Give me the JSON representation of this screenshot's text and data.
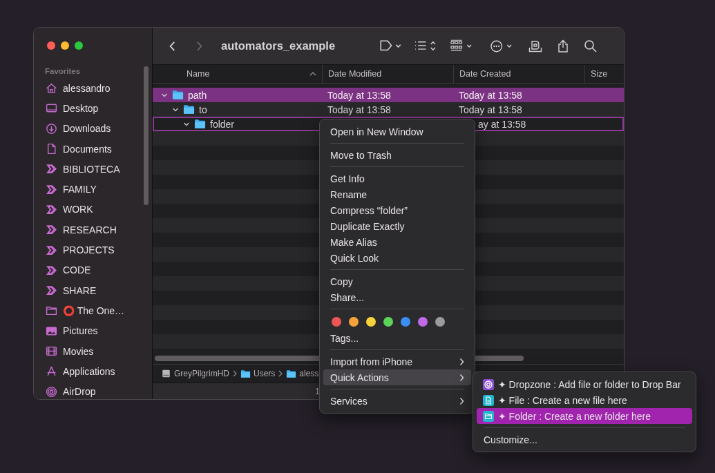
{
  "window": {
    "title": "automators_example"
  },
  "toolbar": {
    "back": {
      "disabled": false
    },
    "forward": {
      "disabled": true
    }
  },
  "sidebar": {
    "section": "Favorites",
    "items": [
      {
        "label": "alessandro",
        "kind": "home"
      },
      {
        "label": "Desktop",
        "kind": "desktop"
      },
      {
        "label": "Downloads",
        "kind": "downloads"
      },
      {
        "label": "Documents",
        "kind": "document"
      },
      {
        "label": "BIBLIOTECA",
        "kind": "shortcut"
      },
      {
        "label": "FAMILY",
        "kind": "shortcut"
      },
      {
        "label": "WORK",
        "kind": "shortcut"
      },
      {
        "label": "RESEARCH",
        "kind": "shortcut"
      },
      {
        "label": "PROJECTS",
        "kind": "shortcut"
      },
      {
        "label": "CODE",
        "kind": "shortcut"
      },
      {
        "label": "SHARE",
        "kind": "shortcut"
      },
      {
        "label": "⭕ The One…",
        "kind": "folder"
      },
      {
        "label": "Pictures",
        "kind": "pictures"
      },
      {
        "label": "Movies",
        "kind": "movies"
      },
      {
        "label": "Applications",
        "kind": "applications"
      },
      {
        "label": "AirDrop",
        "kind": "airdrop"
      }
    ]
  },
  "table": {
    "columns": [
      {
        "label": "Name",
        "sorted": true
      },
      {
        "label": "Date Modified",
        "sorted": false
      },
      {
        "label": "Date Created",
        "sorted": false
      },
      {
        "label": "Size",
        "sorted": false
      }
    ],
    "rows": [
      {
        "name": "path",
        "modified": "Today at 13:58",
        "created": "Today at 13:58",
        "expanded": true,
        "selected": true,
        "context_target": false,
        "children": [
          {
            "name": "to",
            "modified": "Today at 13:58",
            "created": "Today at 13:58",
            "expanded": true,
            "selected": false,
            "context_target": false,
            "children": [
              {
                "name": "folder",
                "created": "ay at 13:58",
                "created_cut": true,
                "expanded": true,
                "selected": false,
                "context_target": true
              }
            ]
          }
        ]
      }
    ]
  },
  "path_bar": {
    "left": [
      {
        "label": "GreyPilgrimHD",
        "kind": "disk"
      },
      {
        "label": "Users",
        "kind": "folder"
      },
      {
        "label": "aless",
        "kind": "folder"
      }
    ]
  },
  "status_bar": {
    "text": "1"
  },
  "context_menu": {
    "items": [
      {
        "kind": "item",
        "label": "Open in New Window"
      },
      {
        "kind": "separator"
      },
      {
        "kind": "item",
        "label": "Move to Trash"
      },
      {
        "kind": "separator"
      },
      {
        "kind": "item",
        "label": "Get Info"
      },
      {
        "kind": "item",
        "label": "Rename"
      },
      {
        "kind": "item",
        "label": "Compress “folder”"
      },
      {
        "kind": "item",
        "label": "Duplicate Exactly"
      },
      {
        "kind": "item",
        "label": "Make Alias"
      },
      {
        "kind": "item",
        "label": "Quick Look"
      },
      {
        "kind": "separator"
      },
      {
        "kind": "item",
        "label": "Copy"
      },
      {
        "kind": "item",
        "label": "Share..."
      },
      {
        "kind": "separator"
      },
      {
        "kind": "tags",
        "tags": [
          {
            "color": "#ef5552"
          },
          {
            "color": "#f5a23a"
          },
          {
            "color": "#f4d33b"
          },
          {
            "color": "#5cd45a"
          },
          {
            "color": "#3a8ff5"
          },
          {
            "color": "#c06ae8"
          },
          {
            "color": "#9b9b9b"
          }
        ]
      },
      {
        "kind": "item",
        "label": "Tags..."
      },
      {
        "kind": "separator"
      },
      {
        "kind": "submenu",
        "label": "Import from iPhone",
        "selected": false
      },
      {
        "kind": "submenu",
        "label": "Quick Actions",
        "selected": true
      },
      {
        "kind": "separator"
      },
      {
        "kind": "submenu",
        "label": "Services",
        "selected": false
      }
    ]
  },
  "submenu": {
    "items": [
      {
        "kind": "dropzone",
        "label": "✦ Dropzone : Add file or folder to Drop Bar",
        "selected": false
      },
      {
        "kind": "file",
        "label": "✦ File : Create a new file here",
        "selected": false
      },
      {
        "kind": "folder",
        "label": "✦ Folder : Create a new folder here",
        "selected": true
      },
      {
        "kind": "separator"
      },
      {
        "kind": "item",
        "label": "Customize..."
      }
    ]
  }
}
